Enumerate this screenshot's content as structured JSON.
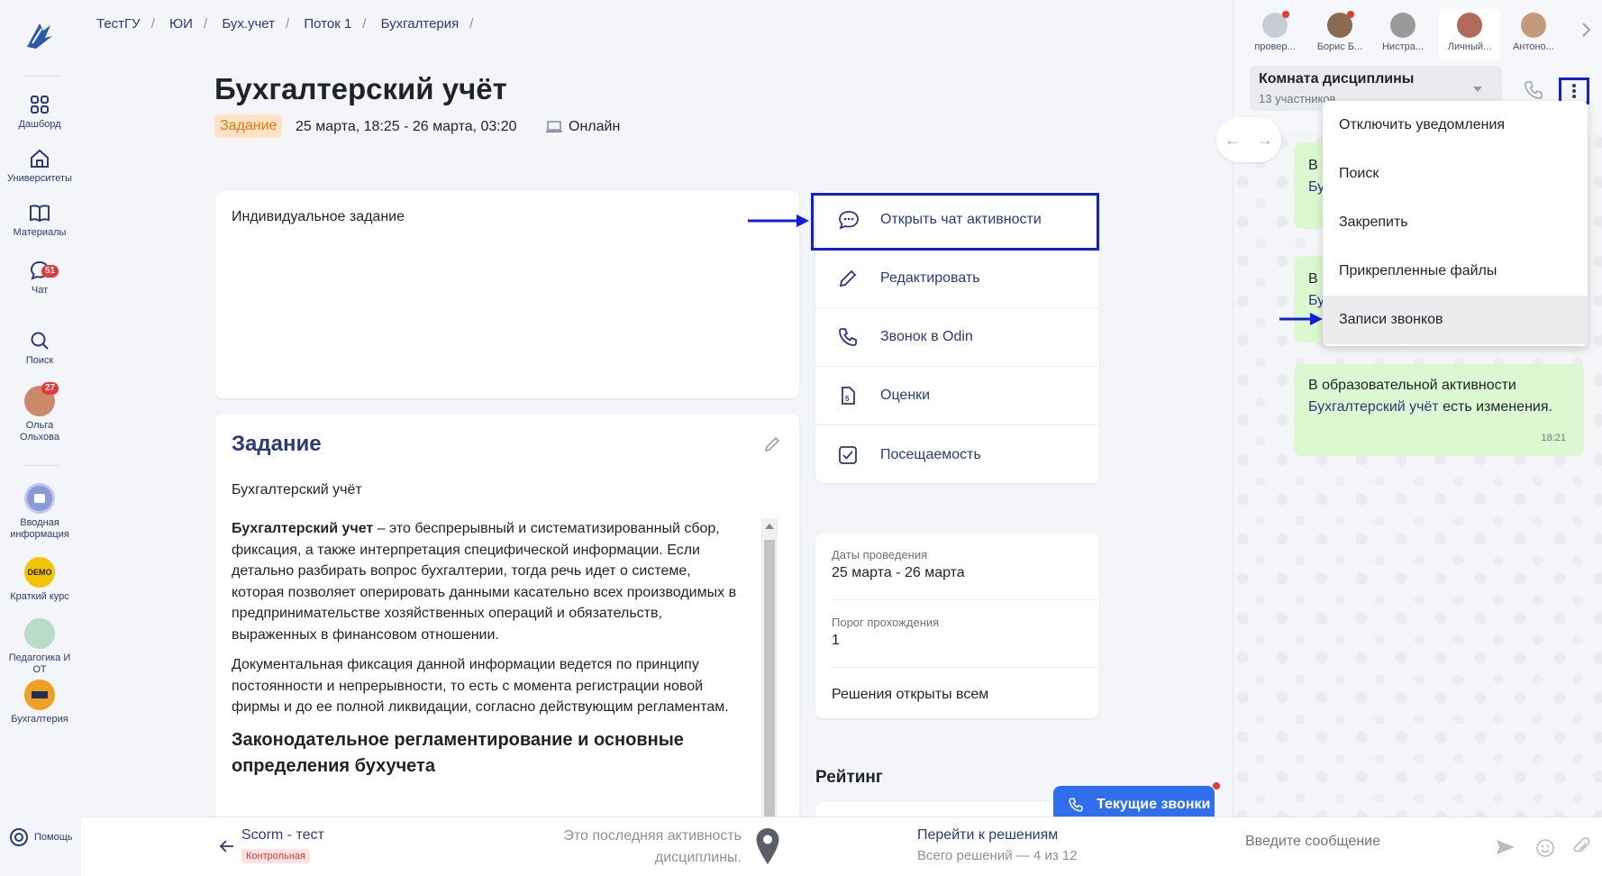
{
  "nav": {
    "items": [
      {
        "label": "Дашборд"
      },
      {
        "label": "Университеты"
      },
      {
        "label": "Материалы"
      },
      {
        "label": "Чат",
        "badge": "51"
      },
      {
        "label": "Поиск"
      },
      {
        "label": "Ольга Ольхова",
        "badge": "27"
      }
    ],
    "courses": [
      {
        "label": "Вводная информация"
      },
      {
        "label": "Краткий курс",
        "avatar_text": "DEMO"
      },
      {
        "label": "Педагогика И ОТ"
      },
      {
        "label": "Бухгалтерия"
      }
    ],
    "help": "Помощь"
  },
  "breadcrumb": [
    "ТестГУ",
    "ЮИ",
    "Бух.учет",
    "Поток 1",
    "Бухгалтерия"
  ],
  "page": {
    "title": "Бухгалтерский учёт",
    "tag": "Задание",
    "dates": "25 марта, 18:25 - 26 марта, 03:20",
    "mode": "Онлайн"
  },
  "description": "Индивидуальное задание",
  "task": {
    "title": "Задание",
    "subtitle": "Бухгалтерский учёт",
    "p1_bold": "Бухгалтерский учет",
    "p1_rest": " – это беспрерывный и систематизированный сбор, фиксация, а также интерпретация специфической информации. Если детально разбирать вопрос бухгалтерии, тогда речь идет о системе, которая позволяет оперировать данными касательно всех производимых в предпринимательстве хозяйственных операций и обязательств, выраженных в финансовом отношении.",
    "p2": "Документальная фиксация данной информации ведется по принципу постоянности и непрерывности, то есть с момента регистрации новой фирмы и до ее полной ликвидации, согласно действующим регламентам.",
    "h3": "Законодательное регламентирование и основные определения бухучета"
  },
  "actions": [
    {
      "label": "Открыть чат активности",
      "icon": "chat-bubble-icon"
    },
    {
      "label": "Редактировать",
      "icon": "pencil-icon"
    },
    {
      "label": "Звонок в Odin",
      "icon": "phone-icon"
    },
    {
      "label": "Оценки",
      "icon": "grades-doc-icon"
    },
    {
      "label": "Посещаемость",
      "icon": "checkbox-icon"
    }
  ],
  "info": {
    "dates_label": "Даты проведения",
    "dates_value": "25 марта - 26 марта",
    "threshold_label": "Порог прохождения",
    "threshold_value": "1",
    "solutions_open": "Решения открыты всем"
  },
  "rating_title": "Рейтинг",
  "current_calls": "Текущие звонки",
  "bottom": {
    "prev_title": "Scorm - тест",
    "prev_tag": "Контрольная",
    "last_note": "Это последняя активность дисциплины.",
    "go_solutions": "Перейти к решениям",
    "solutions_count": "Всего решений — 4 из 12"
  },
  "chat": {
    "tabs": [
      "провер...",
      "Борис Б...",
      "Нистра...",
      "Личный...",
      "Антоно..."
    ],
    "room_name": "Комната дисциплины",
    "room_count": "13 участников",
    "menu": [
      "Отключить уведомления",
      "Поиск",
      "Закрепить",
      "Прикрепленные файлы",
      "Записи звонков"
    ],
    "bubble_partial_1": "В",
    "bubble_partial_1b": "Бу",
    "bubble_partial_2": "В",
    "bubble_partial_2b": "Бу",
    "message_prefix": "В образовательной активности ",
    "message_link": "Бухгалтерский учёт",
    "message_suffix": " есть изменения.",
    "message_time": "18:21",
    "input_placeholder": "Введите сообщение"
  },
  "colors": {
    "accent": "#2a3a7a",
    "highlight": "#1020e0",
    "badge": "#e53935",
    "tag_bg": "#ffe3c4",
    "tag_fg": "#e07a12",
    "bubble": "#dcf8d0",
    "calls_btn": "#2f6fed"
  }
}
